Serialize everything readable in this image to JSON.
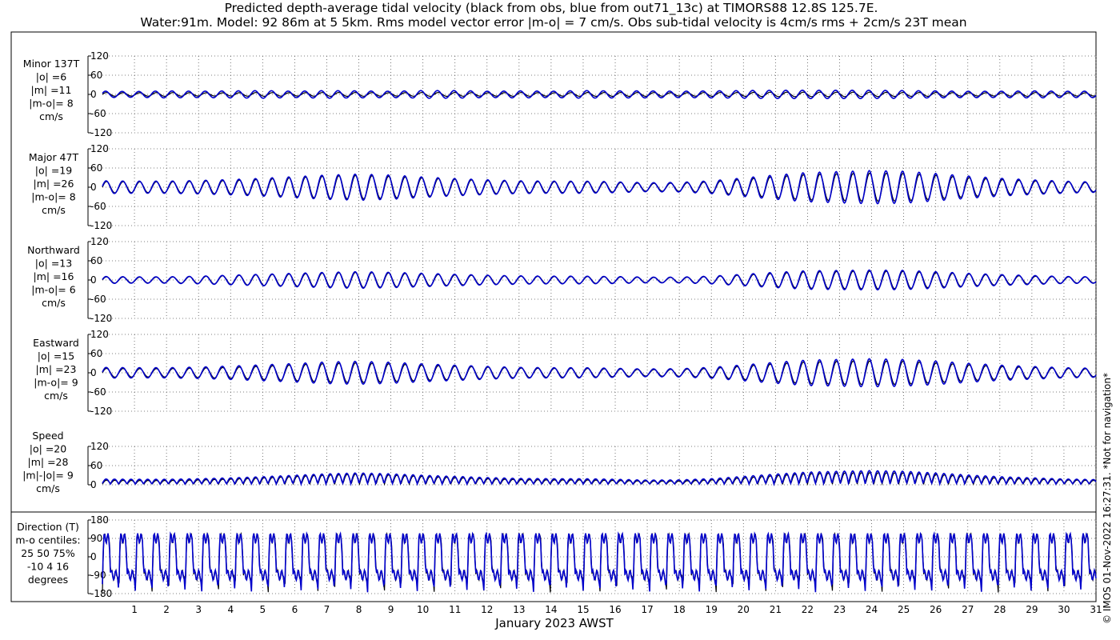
{
  "title_line1": "Predicted depth-average tidal velocity (black from obs, blue from out71_13c) at TIMORS88 12.8S 125.7E.",
  "title_line2": "Water:91m. Model: 92 86m at 5 5km. Rms model vector error |m-o| = 7 cm/s. Obs sub-tidal velocity is 4cm/s rms + 2cm/s 23T mean",
  "xlabel": "January 2023 AWST",
  "side_note": "© IMOS 01-Nov-2022 16:27:31. *Not for navigation*",
  "colors": {
    "obs": "#000000",
    "model": "#0000cc",
    "grid": "#555555"
  },
  "chart_data": [
    {
      "type": "line",
      "labels": [
        "Minor 137T",
        "|o| =6",
        "|m| =11",
        "|m-o|= 8",
        "cm/s"
      ],
      "ylim": [
        -120,
        120
      ],
      "yticks": [
        -120,
        -60,
        0,
        60,
        120
      ],
      "ytick_labels": [
        "-120",
        "-60",
        "0",
        "60",
        "120"
      ],
      "xlim": [
        0,
        31
      ],
      "series": [
        {
          "color": "obs",
          "amplitude": 6,
          "envelope": [
            6,
            5,
            6,
            5,
            5,
            6,
            5,
            6,
            6,
            5,
            6,
            6,
            5,
            6,
            5,
            6,
            6,
            6,
            5,
            6,
            6,
            7,
            7,
            7,
            7,
            6,
            6,
            5,
            5,
            6,
            5,
            5
          ],
          "phase_deg": 0
        },
        {
          "color": "model",
          "amplitude": 11,
          "envelope": [
            10,
            9,
            11,
            10,
            11,
            12,
            10,
            12,
            11,
            10,
            12,
            12,
            10,
            11,
            10,
            12,
            11,
            11,
            10,
            11,
            12,
            13,
            13,
            13,
            13,
            12,
            11,
            10,
            10,
            11,
            10,
            10
          ],
          "phase_deg": 20
        }
      ]
    },
    {
      "type": "line",
      "labels": [
        "Major 47T",
        "|o| =19",
        "|m| =26",
        "|m-o|= 8",
        "cm/s"
      ],
      "ylim": [
        -120,
        120
      ],
      "yticks": [
        -120,
        -60,
        0,
        60,
        120
      ],
      "ytick_labels": [
        "-120",
        "-60",
        "0",
        "60",
        "120"
      ],
      "xlim": [
        0,
        31
      ],
      "series": [
        {
          "color": "obs",
          "amplitude": 19,
          "envelope": [
            18,
            17,
            17,
            19,
            21,
            25,
            30,
            35,
            37,
            34,
            29,
            25,
            21,
            18,
            17,
            17,
            15,
            12,
            13,
            17,
            25,
            33,
            40,
            42,
            44,
            43,
            37,
            30,
            24,
            20,
            17,
            14
          ],
          "phase_deg": 0
        },
        {
          "color": "model",
          "amplitude": 26,
          "envelope": [
            20,
            19,
            19,
            21,
            24,
            28,
            33,
            38,
            41,
            38,
            32,
            27,
            23,
            20,
            19,
            19,
            17,
            14,
            15,
            20,
            29,
            38,
            46,
            49,
            52,
            50,
            43,
            35,
            28,
            23,
            19,
            16
          ],
          "phase_deg": 8
        }
      ]
    },
    {
      "type": "line",
      "labels": [
        "Northward",
        "|o| =13",
        "|m| =16",
        "|m-o|= 6",
        "cm/s"
      ],
      "ylim": [
        -120,
        120
      ],
      "yticks": [
        -120,
        -60,
        0,
        60,
        120
      ],
      "ytick_labels": [
        "-120",
        "-60",
        "0",
        "60",
        "120"
      ],
      "xlim": [
        0,
        31
      ],
      "series": [
        {
          "color": "obs",
          "amplitude": 13,
          "envelope": [
            10,
            9,
            9,
            11,
            14,
            17,
            19,
            22,
            24,
            22,
            19,
            16,
            14,
            12,
            11,
            11,
            10,
            8,
            8,
            11,
            16,
            21,
            26,
            27,
            28,
            27,
            23,
            19,
            15,
            12,
            10,
            9
          ],
          "phase_deg": 0
        },
        {
          "color": "model",
          "amplitude": 16,
          "envelope": [
            11,
            10,
            10,
            12,
            15,
            18,
            21,
            24,
            26,
            24,
            21,
            18,
            15,
            13,
            12,
            12,
            11,
            9,
            9,
            12,
            18,
            24,
            29,
            30,
            31,
            30,
            26,
            21,
            17,
            14,
            11,
            10
          ],
          "phase_deg": 8
        }
      ]
    },
    {
      "type": "line",
      "labels": [
        "Eastward",
        "|o| =15",
        "|m| =23",
        "|m-o|= 9",
        "cm/s"
      ],
      "ylim": [
        -120,
        120
      ],
      "yticks": [
        -120,
        -60,
        0,
        60,
        120
      ],
      "ytick_labels": [
        "-120",
        "-60",
        "0",
        "60",
        "120"
      ],
      "xlim": [
        0,
        31
      ],
      "series": [
        {
          "color": "obs",
          "amplitude": 15,
          "envelope": [
            14,
            13,
            13,
            15,
            17,
            21,
            25,
            29,
            31,
            28,
            24,
            21,
            18,
            15,
            14,
            14,
            12,
            10,
            11,
            14,
            21,
            28,
            34,
            36,
            37,
            36,
            31,
            25,
            20,
            17,
            14,
            12
          ],
          "phase_deg": 0
        },
        {
          "color": "model",
          "amplitude": 23,
          "envelope": [
            17,
            16,
            16,
            18,
            21,
            25,
            29,
            34,
            36,
            33,
            28,
            24,
            20,
            17,
            16,
            16,
            14,
            12,
            13,
            17,
            25,
            33,
            40,
            42,
            44,
            42,
            37,
            30,
            24,
            20,
            16,
            14
          ],
          "phase_deg": 8
        }
      ]
    },
    {
      "type": "line",
      "labels": [
        "Speed",
        "|o| =20",
        "|m| =28",
        "|m|-|o|= 9",
        "cm/s"
      ],
      "ylim": [
        0,
        120
      ],
      "yticks": [
        0,
        60,
        120
      ],
      "ytick_labels": [
        "0",
        "60",
        "120"
      ],
      "xlim": [
        0,
        31
      ],
      "series": [
        {
          "color": "obs",
          "amplitude": 20,
          "envelope": [
            14,
            13,
            13,
            15,
            18,
            22,
            27,
            32,
            35,
            32,
            27,
            23,
            19,
            16,
            15,
            15,
            13,
            11,
            11,
            15,
            22,
            30,
            37,
            39,
            40,
            39,
            34,
            27,
            21,
            18,
            15,
            13
          ],
          "phase_deg": 0
        },
        {
          "color": "model",
          "amplitude": 28,
          "envelope": [
            18,
            17,
            17,
            19,
            22,
            26,
            31,
            36,
            39,
            36,
            31,
            27,
            23,
            20,
            19,
            19,
            17,
            14,
            15,
            19,
            27,
            35,
            42,
            45,
            47,
            45,
            39,
            32,
            26,
            22,
            18,
            16
          ],
          "phase_deg": 8
        }
      ]
    },
    {
      "type": "line",
      "labels": [
        "Direction (T)",
        "m-o centiles:",
        "25  50  75%",
        "-10   4  16",
        "degrees"
      ],
      "ylim": [
        -180,
        180
      ],
      "yticks": [
        -180,
        -90,
        0,
        90,
        180
      ],
      "ytick_labels": [
        "-180",
        "-90",
        "0",
        "90",
        "180"
      ],
      "xlim": [
        0,
        31
      ],
      "series": [
        {
          "color": "obs",
          "shape": "direction",
          "offset_deg": 0
        },
        {
          "color": "model",
          "shape": "direction",
          "offset_deg": 4
        }
      ]
    }
  ],
  "xticks": [
    1,
    2,
    3,
    4,
    5,
    6,
    7,
    8,
    9,
    10,
    11,
    12,
    13,
    14,
    15,
    16,
    17,
    18,
    19,
    20,
    21,
    22,
    23,
    24,
    25,
    26,
    27,
    28,
    29,
    30,
    31
  ],
  "xtick_labels": [
    "1",
    "2",
    "3",
    "4",
    "5",
    "6",
    "7",
    "8",
    "9",
    "10",
    "11",
    "12",
    "13",
    "14",
    "15",
    "16",
    "17",
    "18",
    "19",
    "20",
    "21",
    "22",
    "23",
    "24",
    "25",
    "26",
    "27",
    "28",
    "29",
    "30",
    "31"
  ]
}
